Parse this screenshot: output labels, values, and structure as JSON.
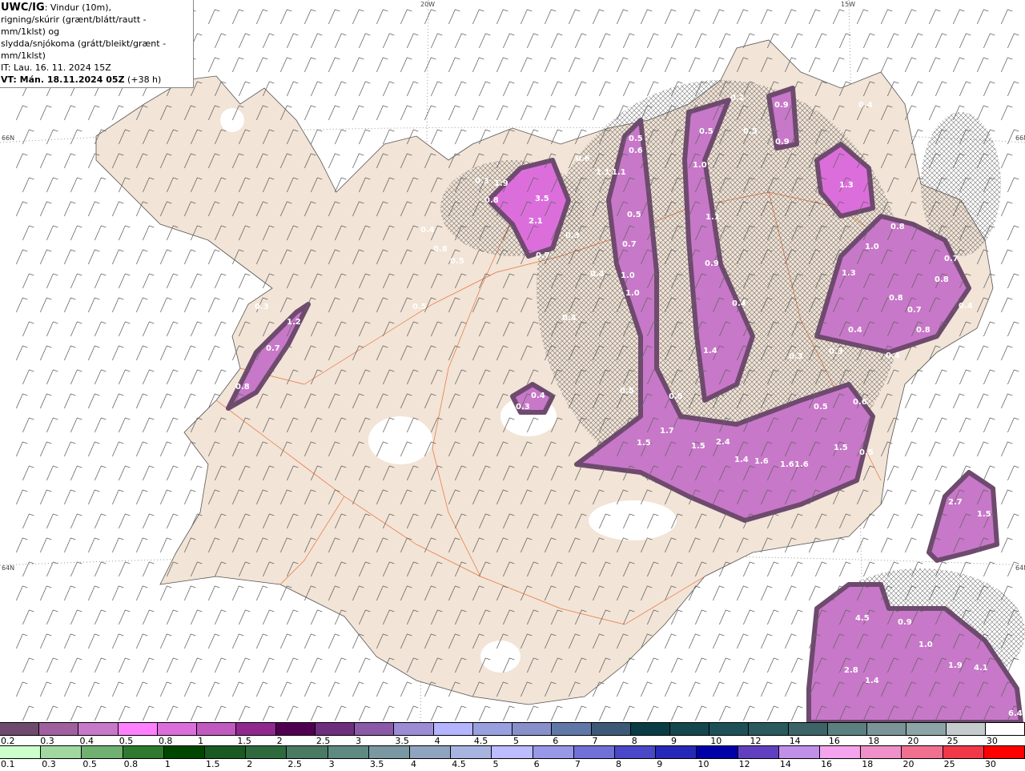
{
  "header": {
    "product": "UWC/IG",
    "title_rest": ": Vindur (10m),",
    "line2": "rigning/skúrir (grænt/blátt/rautt - mm/1klst) og",
    "line3": "slydda/snjókoma (grátt/bleikt/grænt - mm/1klst)",
    "issue_time": "IT: Lau. 16. 11. 2024 15Z",
    "valid_time": "VT: Mán. 18.11.2024 05Z",
    "lead": " (+38 h)"
  },
  "graticule": {
    "lon": [
      "20W",
      "15W"
    ],
    "lat": [
      "66N",
      "64N"
    ]
  },
  "colors": {
    "land": "#f2e4d6",
    "sea": "#ffffff",
    "roads": "#e8703a",
    "precip_core": "#c05ac0"
  },
  "precip_labels": [
    "3.5",
    "2.1",
    "1.1",
    "1.1",
    "0.6",
    "0.5",
    "0.6",
    "1.9",
    "0.3",
    "0.8",
    "0.5",
    "0.7",
    "1.0",
    "1.0",
    "0.4",
    "0.3",
    "0.7",
    "0.4",
    "0.8",
    "0.5",
    "0.5",
    "0.4",
    "0.5",
    "1.0",
    "1.1",
    "0.9",
    "0.4",
    "1.4",
    "0.5",
    "0.9",
    "0.9",
    "0.4",
    "1.3",
    "0.8",
    "1.0",
    "1.3",
    "0.7",
    "0.8",
    "0.8",
    "0.7",
    "0.4",
    "0.8",
    "0.4",
    "0.3",
    "0.3",
    "0.4",
    "0.5",
    "0.5",
    "0.6",
    "0.5",
    "1.7",
    "1.5",
    "1.5",
    "2.4",
    "1.4",
    "1.6",
    "1.6",
    "1.6",
    "1.5",
    "0.5",
    "0.4",
    "0.3",
    "1.2",
    "0.7",
    "0.8",
    "0.3",
    "2.7",
    "1.5",
    "4.5",
    "0.9",
    "1.0",
    "1.9",
    "4.1",
    "2.8",
    "1.4",
    "6.4",
    "0.5",
    "0.2"
  ],
  "legend_sleet_snow": {
    "labels": [
      "0.2",
      "0.3",
      "0.4",
      "0.5",
      "0.8",
      "1",
      "1.5",
      "2",
      "2.5",
      "3",
      "3.5",
      "4",
      "4.5",
      "5",
      "6",
      "7",
      "8",
      "9",
      "10",
      "12",
      "14",
      "16",
      "18",
      "20",
      "25",
      "30"
    ],
    "colors": [
      "#6e4a6e",
      "#a0609f",
      "#c878c8",
      "#ff80ff",
      "#dc6edc",
      "#c05ac0",
      "#902890",
      "#500050",
      "#6e2e7e",
      "#8a5aa8",
      "#9c8cd6",
      "#b4b4ff",
      "#98a0e0",
      "#8890cc",
      "#6078a8",
      "#3c5a78",
      "#0a3c46",
      "#14464e",
      "#1e5058",
      "#285a5e",
      "#3c6468",
      "#5a8080",
      "#7a9498",
      "#8ca4a6",
      "#c4cccc",
      "#ffffff"
    ]
  },
  "legend_rain": {
    "labels": [
      "0.1",
      "0.3",
      "0.5",
      "0.8",
      "1",
      "1.5",
      "2",
      "2.5",
      "3",
      "3.5",
      "4",
      "4.5",
      "5",
      "6",
      "7",
      "8",
      "9",
      "10",
      "12",
      "14",
      "16",
      "18",
      "20",
      "25",
      "30"
    ],
    "colors": [
      "#ccffcc",
      "#a0d8a0",
      "#70b070",
      "#2e7a2e",
      "#004800",
      "#1a5a22",
      "#2e6a3e",
      "#4a7a62",
      "#5e8a82",
      "#7a98a2",
      "#90a4c0",
      "#a8b4e0",
      "#bcbcff",
      "#9898e8",
      "#7070d8",
      "#4848c8",
      "#2828b8",
      "#0000a8",
      "#6040c0",
      "#c090e8",
      "#f4a4ec",
      "#f090c8",
      "#f07090",
      "#f03848",
      "#ff0000"
    ]
  }
}
